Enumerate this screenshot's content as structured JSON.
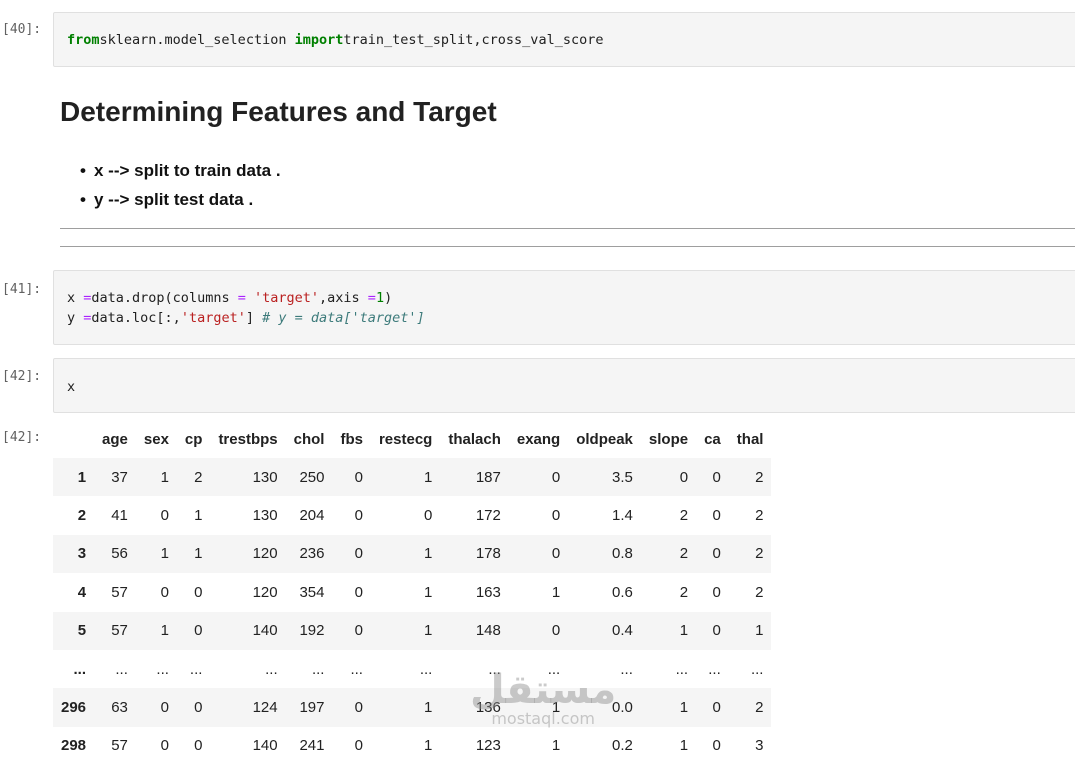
{
  "cells": {
    "c40": {
      "prompt": "[40]:",
      "code": [
        [
          [
            "kw",
            "from"
          ],
          [
            "",
            "sklearn.model_selection "
          ],
          [
            "kw",
            "import"
          ],
          [
            "",
            "train_test_split,cross_val_score"
          ]
        ]
      ]
    },
    "markdown": {
      "heading": "Determining Features and Target",
      "bullets": [
        "x --> split to train data .",
        "y --> split test data ."
      ]
    },
    "c41": {
      "prompt": "[41]:",
      "code": [
        [
          [
            "",
            "x "
          ],
          [
            "op",
            "="
          ],
          [
            "",
            "data.drop(columns "
          ],
          [
            "op",
            "="
          ],
          [
            "str",
            " 'target'"
          ],
          [
            "",
            ",axis "
          ],
          [
            "op",
            "="
          ],
          [
            "num",
            "1"
          ],
          [
            "",
            ")"
          ]
        ],
        [
          [
            "",
            "y "
          ],
          [
            "op",
            "="
          ],
          [
            "",
            "data.loc[:,"
          ],
          [
            "str",
            "'target'"
          ],
          [
            "",
            "] "
          ],
          [
            "cmt",
            "# y = data['target']"
          ]
        ]
      ]
    },
    "c42": {
      "prompt": "[42]:",
      "code": [
        [
          [
            "",
            "x"
          ]
        ]
      ]
    },
    "out42": {
      "prompt": "[42]:"
    }
  },
  "dataframe": {
    "columns": [
      "",
      "age",
      "sex",
      "cp",
      "trestbps",
      "chol",
      "fbs",
      "restecg",
      "thalach",
      "exang",
      "oldpeak",
      "slope",
      "ca",
      "thal"
    ],
    "rows": [
      [
        "1",
        "37",
        "1",
        "2",
        "130",
        "250",
        "0",
        "1",
        "187",
        "0",
        "3.5",
        "0",
        "0",
        "2"
      ],
      [
        "2",
        "41",
        "0",
        "1",
        "130",
        "204",
        "0",
        "0",
        "172",
        "0",
        "1.4",
        "2",
        "0",
        "2"
      ],
      [
        "3",
        "56",
        "1",
        "1",
        "120",
        "236",
        "0",
        "1",
        "178",
        "0",
        "0.8",
        "2",
        "0",
        "2"
      ],
      [
        "4",
        "57",
        "0",
        "0",
        "120",
        "354",
        "0",
        "1",
        "163",
        "1",
        "0.6",
        "2",
        "0",
        "2"
      ],
      [
        "5",
        "57",
        "1",
        "0",
        "140",
        "192",
        "0",
        "1",
        "148",
        "0",
        "0.4",
        "1",
        "0",
        "1"
      ],
      [
        "...",
        "...",
        "...",
        "...",
        "...",
        "...",
        "...",
        "...",
        "...",
        "...",
        "...",
        "...",
        "...",
        "..."
      ],
      [
        "296",
        "63",
        "0",
        "0",
        "124",
        "197",
        "0",
        "1",
        "136",
        "1",
        "0.0",
        "1",
        "0",
        "2"
      ],
      [
        "298",
        "57",
        "0",
        "0",
        "140",
        "241",
        "0",
        "1",
        "123",
        "1",
        "0.2",
        "1",
        "0",
        "3"
      ]
    ]
  },
  "watermark": {
    "arabic": "مستقل",
    "latin": "mostaql.com"
  }
}
